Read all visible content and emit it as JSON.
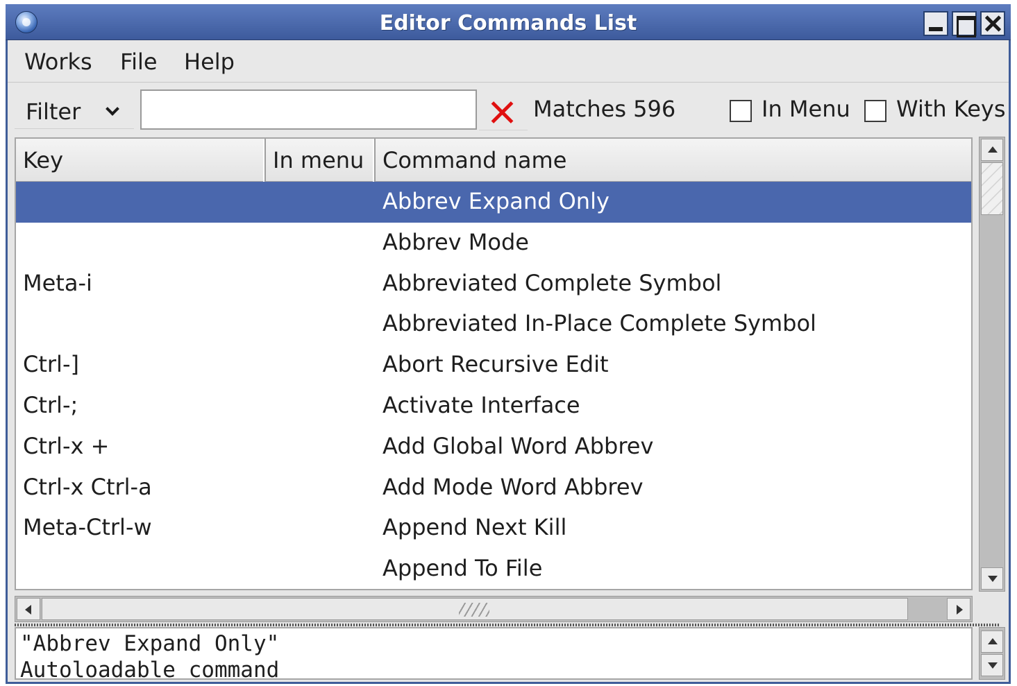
{
  "window": {
    "title": "Editor Commands List",
    "controls": [
      "minimize",
      "maximize",
      "close"
    ]
  },
  "menubar": {
    "items": [
      "Works",
      "File",
      "Help"
    ]
  },
  "filterbar": {
    "filter_label": "Filter",
    "filter_value": "",
    "matches_label": "Matches 596",
    "in_menu_label": "In Menu",
    "in_menu_checked": false,
    "with_keys_label": "With Keys",
    "with_keys_checked": false
  },
  "table": {
    "columns": [
      "Key",
      "In menu",
      "Command name"
    ],
    "selected_index": 0,
    "rows": [
      {
        "key": "",
        "in_menu": "",
        "command": "Abbrev Expand Only"
      },
      {
        "key": "",
        "in_menu": "",
        "command": "Abbrev Mode"
      },
      {
        "key": "Meta-i",
        "in_menu": "",
        "command": "Abbreviated Complete Symbol"
      },
      {
        "key": "",
        "in_menu": "",
        "command": "Abbreviated In-Place Complete Symbol"
      },
      {
        "key": "Ctrl-]",
        "in_menu": "",
        "command": "Abort Recursive Edit"
      },
      {
        "key": "Ctrl-;",
        "in_menu": "",
        "command": "Activate Interface"
      },
      {
        "key": "Ctrl-x +",
        "in_menu": "",
        "command": "Add Global Word Abbrev"
      },
      {
        "key": "Ctrl-x Ctrl-a",
        "in_menu": "",
        "command": "Add Mode Word Abbrev"
      },
      {
        "key": "Meta-Ctrl-w",
        "in_menu": "",
        "command": "Append Next Kill"
      },
      {
        "key": "",
        "in_menu": "",
        "command": "Append To File"
      }
    ]
  },
  "info": {
    "lines": [
      "\"Abbrev Expand Only\"",
      "Autoloadable command"
    ]
  },
  "colors": {
    "titlebar": "#4a6aad",
    "selection": "#4a67ad",
    "clear_icon": "#e01010"
  }
}
